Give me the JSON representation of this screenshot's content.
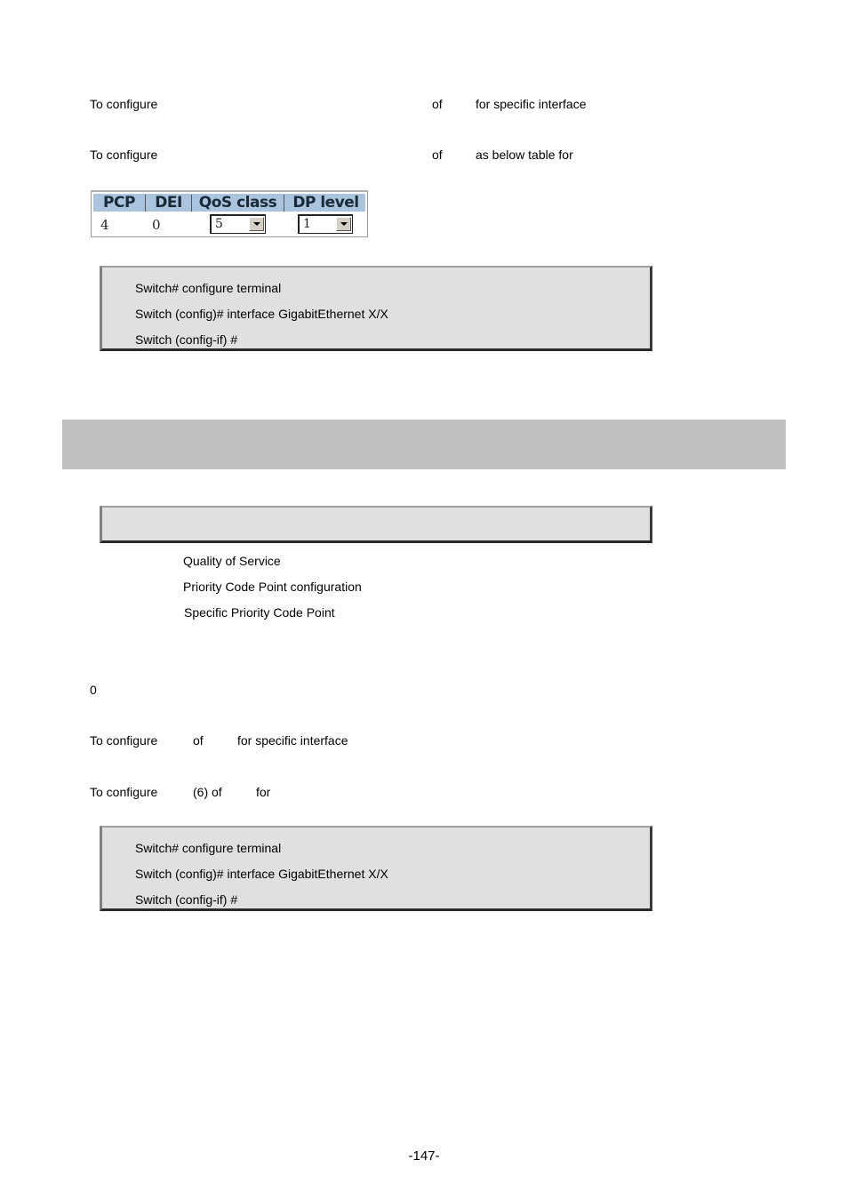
{
  "section1": {
    "p1": {
      "a": "To configure",
      "b": "of",
      "c": "for specific interface"
    },
    "p2": {
      "a": "To configure",
      "b": "of",
      "c": "as below table for"
    },
    "table": {
      "headers": [
        "PCP",
        "DEI",
        "QoS class",
        "DP level"
      ],
      "row": {
        "pcp": "4",
        "dei": "0",
        "qos_class": "5",
        "dp_level": "1"
      }
    },
    "cli": [
      "Switch# configure terminal",
      "Switch (config)# interface GigabitEthernet X/X",
      "Switch (config-if) #"
    ]
  },
  "section2": {
    "banner_text": "",
    "syntax_box_text": "",
    "params": [
      "Quality of Service",
      "Priority Code Point configuration",
      "Specific Priority Code Point"
    ],
    "default_value": "0",
    "p1": {
      "a": "To configure",
      "b": "of",
      "c": "for specific interface"
    },
    "p2": {
      "a": "To configure",
      "b": "(6) of",
      "c": "for"
    },
    "cli": [
      "Switch# configure terminal",
      "Switch (config)# interface GigabitEthernet X/X",
      "Switch (config-if) #"
    ]
  },
  "footer": {
    "page_number": "-147-"
  }
}
